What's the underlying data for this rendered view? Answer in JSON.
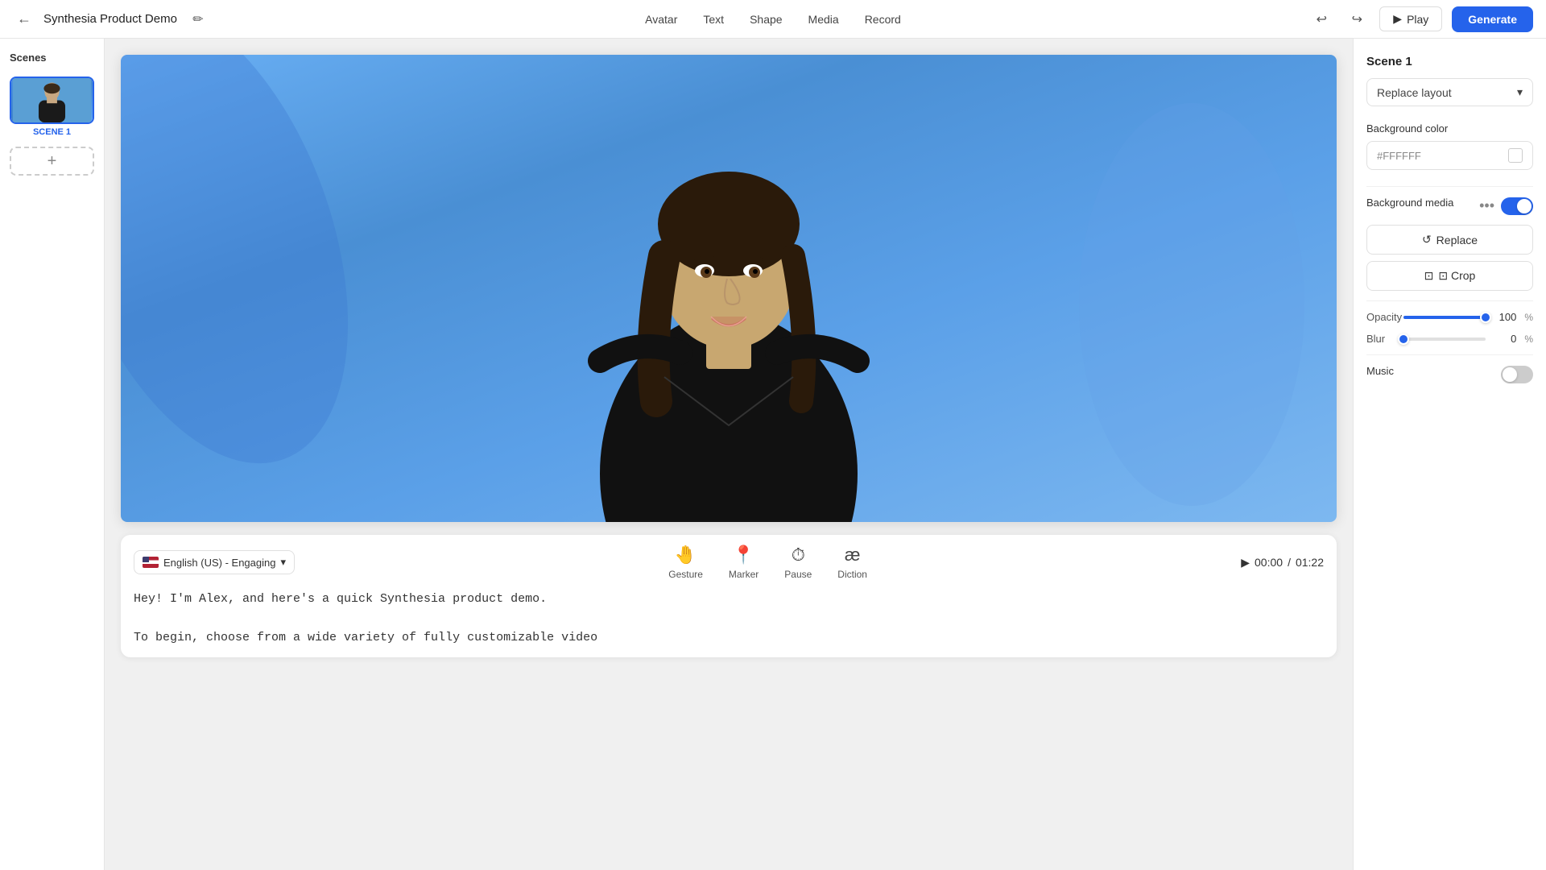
{
  "topbar": {
    "back_icon": "←",
    "project_title": "Synthesia Product Demo",
    "nav_items": [
      "Avatar",
      "Text",
      "Shape",
      "Media",
      "Record"
    ],
    "play_label": "Play",
    "generate_label": "Generate"
  },
  "scenes": {
    "title": "Scenes",
    "items": [
      {
        "label": "SCENE 1",
        "active": true
      }
    ],
    "add_label": "+"
  },
  "canvas": {
    "video_placeholder": ""
  },
  "script": {
    "line1": "Hey! I'm Alex, and here's a quick Synthesia product demo.",
    "line2": "To begin, choose from a wide variety of fully customizable video"
  },
  "bottom_controls": {
    "language": "English (US) - Engaging",
    "lang_dropdown_icon": "▾",
    "gesture_label": "Gesture",
    "marker_label": "Marker",
    "pause_label": "Pause",
    "diction_label": "Diction",
    "current_time": "00:00",
    "total_time": "01:22",
    "play_icon": "▶"
  },
  "right_panel": {
    "scene_title": "Scene 1",
    "replace_layout_label": "Replace layout",
    "replace_layout_icon": "▾",
    "background_color_label": "Background color",
    "color_value": "#FFFFFF",
    "background_media_label": "Background media",
    "dots_icon": "•••",
    "toggle_bg_media": true,
    "replace_btn": "↺  Replace",
    "crop_btn": "⊡  Crop",
    "opacity_label": "Opacity",
    "opacity_value": "100",
    "opacity_percent": "%",
    "blur_label": "Blur",
    "blur_value": "0",
    "blur_percent": "%",
    "music_label": "Music",
    "toggle_music": false
  }
}
